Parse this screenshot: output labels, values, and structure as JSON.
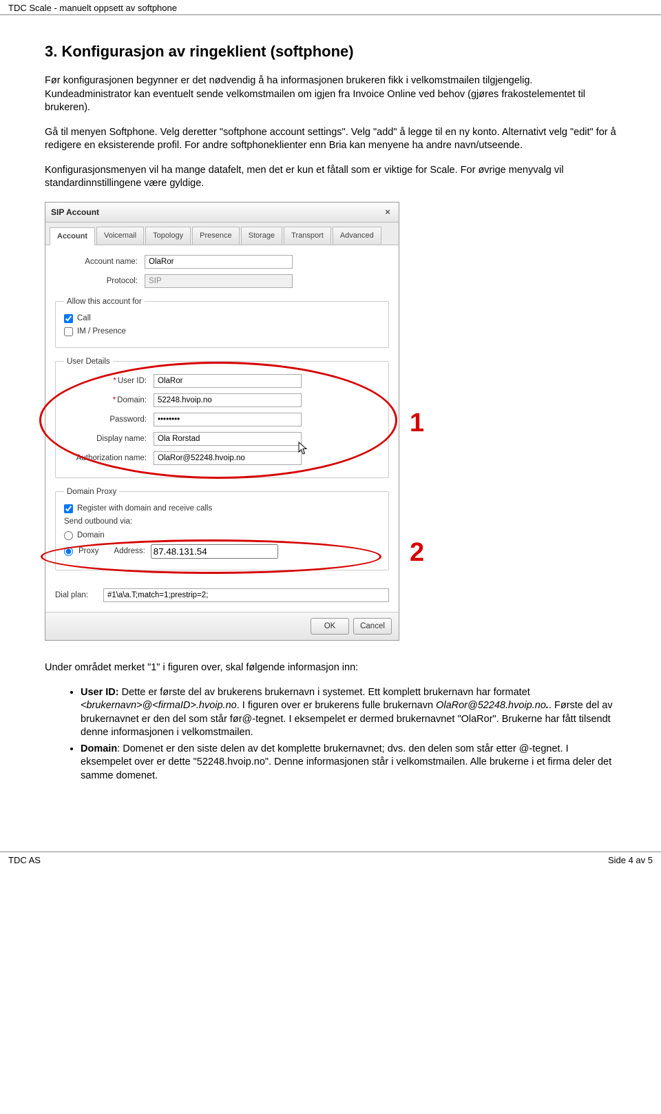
{
  "header": {
    "running_title": "TDC Scale - manuelt oppsett av softphone"
  },
  "section": {
    "title": "3. Konfigurasjon av ringeklient (softphone)",
    "p1": "Før konfigurasjonen begynner er det nødvendig å ha informasjonen brukeren fikk i velkomstmailen tilgjengelig. Kundeadministrator kan eventuelt sende velkomstmailen om igjen fra Invoice Online ved behov (gjøres frakostelementet til brukeren).",
    "p2": "Gå til menyen Softphone. Velg deretter \"softphone account settings\". Velg \"add\" å legge til en ny konto. Alternativt velg \"edit\" for å redigere en eksisterende profil. For andre softphoneklienter enn Bria kan menyene ha andre navn/utseende.",
    "p3": "Konfigurasjonsmenyen vil ha mange datafelt, men det er kun et fåtall som er viktige for Scale. For øvrige menyvalg vil standardinnstillingene være gyldige."
  },
  "dialog": {
    "title": "SIP Account",
    "tabs": [
      "Account",
      "Voicemail",
      "Topology",
      "Presence",
      "Storage",
      "Transport",
      "Advanced"
    ],
    "account_name_label": "Account name:",
    "account_name_value": "OlaRor",
    "protocol_label": "Protocol:",
    "protocol_value": "SIP",
    "allow_legend": "Allow this account for",
    "allow_call": "Call",
    "allow_im": "IM / Presence",
    "user_legend": "User Details",
    "user_id_label": "User ID:",
    "user_id_value": "OlaRor",
    "domain_label": "Domain:",
    "domain_value": "52248.hvoip.no",
    "password_label": "Password:",
    "password_value": "••••••••",
    "display_name_label": "Display name:",
    "display_name_value": "Ola Rorstad",
    "auth_name_label": "Authorization name:",
    "auth_name_value": "OlaRor@52248.hvoip.no",
    "proxy_legend": "Domain Proxy",
    "proxy_register": "Register with domain and receive calls",
    "proxy_send_label": "Send outbound via:",
    "proxy_opt_domain": "Domain",
    "proxy_opt_proxy": "Proxy",
    "proxy_addr_label": "Address:",
    "proxy_addr_value": "87.48.131.54",
    "dial_plan_label": "Dial plan:",
    "dial_plan_value": "#1\\a\\a.T;match=1;prestrip=2;",
    "ok": "OK",
    "cancel": "Cancel"
  },
  "callouts": {
    "one": "1",
    "two": "2"
  },
  "post": {
    "intro": "Under området merket \"1\" i figuren over, skal følgende informasjon inn:",
    "li1_a": "User ID:",
    "li1_b": " Dette er første del av brukerens brukernavn i systemet. Ett komplett brukernavn har formatet ",
    "li1_c": "<brukernavn>@<firmaID>.hvoip.no",
    "li1_d": ". I figuren over er brukerens fulle brukernavn ",
    "li1_e": "OlaRor@52248.hvoip.no",
    "li1_f": ". Første del av brukernavnet er den del som står før@-tegnet. I eksempelet er dermed brukernavnet \"OlaRor\". Brukerne har fått tilsendt denne informasjonen i velkomstmailen.",
    "li2_a": "Domain",
    "li2_b": ": Domenet er den siste delen av det komplette brukernavnet; dvs. den delen som står etter @-tegnet. I eksempelet over er dette \"52248.hvoip.no\". Denne informasjonen står i velkomstmailen. Alle brukerne i et firma deler det samme domenet."
  },
  "footer": {
    "left": "TDC AS",
    "right": "Side 4 av 5"
  }
}
